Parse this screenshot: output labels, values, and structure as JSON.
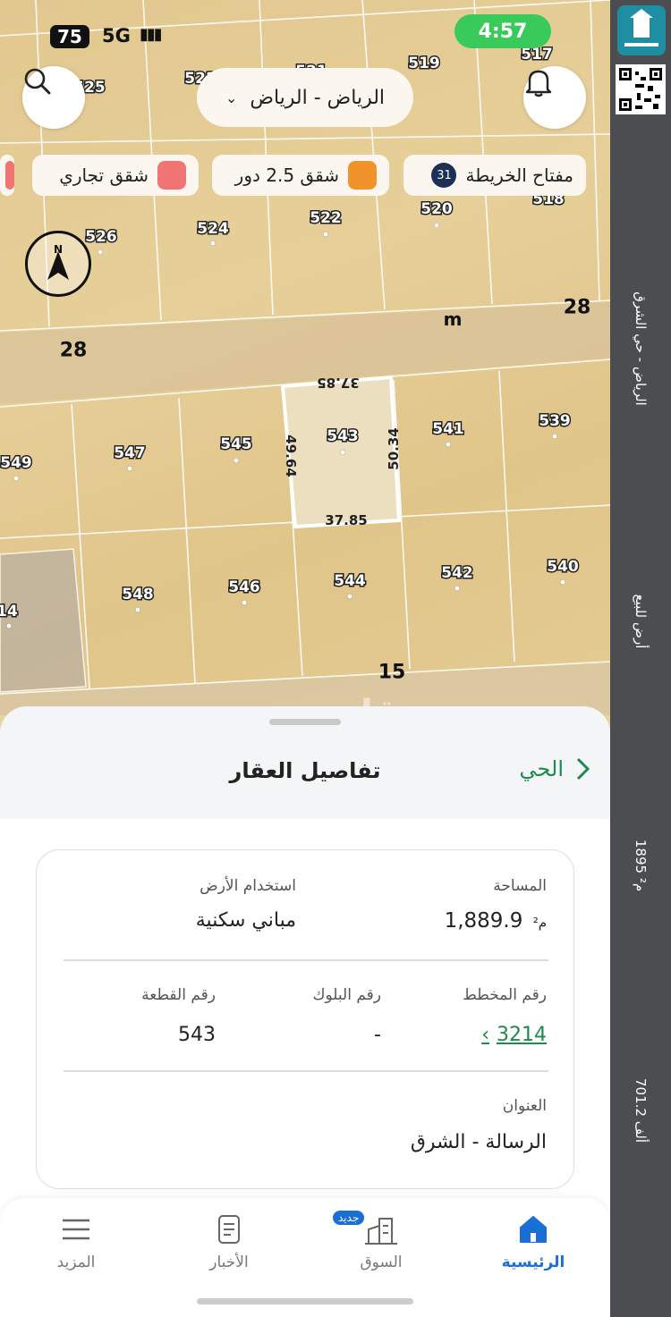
{
  "status_bar": {
    "battery": "75",
    "network": "5G",
    "time": "4:57"
  },
  "header": {
    "city_select": "الرياض - الرياض",
    "search_icon": "search-icon",
    "bell_icon": "bell-icon"
  },
  "chips": {
    "map_key": {
      "label": "مفتاح الخريطة",
      "count": "31"
    },
    "apartments_2_5": {
      "label": "شقق 2.5 دور",
      "color": "#f0932b"
    },
    "commercial": {
      "label": "شقق تجاري",
      "color": "#f07474"
    }
  },
  "map": {
    "plots": [
      "525",
      "523",
      "521",
      "519",
      "517",
      "526",
      "524",
      "522",
      "520",
      "518",
      "549",
      "547",
      "545",
      "543",
      "541",
      "539",
      "14",
      "548",
      "546",
      "544",
      "542",
      "540"
    ],
    "streets": {
      "top_left": "28",
      "top_right": "28",
      "bottom": "15",
      "letter": "m"
    },
    "selected_plot_dims": {
      "top": "37.85",
      "bottom": "37.85",
      "left": "49.64",
      "right": "50.34"
    },
    "watermark": "عقار"
  },
  "sheet": {
    "title": "تفاصيل العقار",
    "district_link": "الحي",
    "area_label": "المساحة",
    "area_value": "1,889.9",
    "area_unit": "م²",
    "land_use_label": "استخدام الأرض",
    "land_use_value": "مباني سكنية",
    "plan_label": "رقم المخطط",
    "plan_value": "3214",
    "block_label": "رقم البلوك",
    "block_value": "-",
    "plot_label": "رقم القطعة",
    "plot_value": "543",
    "address_label": "العنوان",
    "address_value": "الرسالة - الشرق"
  },
  "bottom_nav": {
    "home": "الرئيسية",
    "market": "السوق",
    "market_badge": "جديد",
    "news": "الأخبار",
    "more": "المزيد"
  },
  "side_strip": {
    "location": "الرياض - حي الشرق",
    "listing_type": "أرض للبيع",
    "area": "1895 م²",
    "price": "701.2 ألف"
  },
  "colors": {
    "accent_green": "#1d8a4f",
    "home_blue": "#1a6fd6",
    "time_pill": "#3ac95b"
  }
}
